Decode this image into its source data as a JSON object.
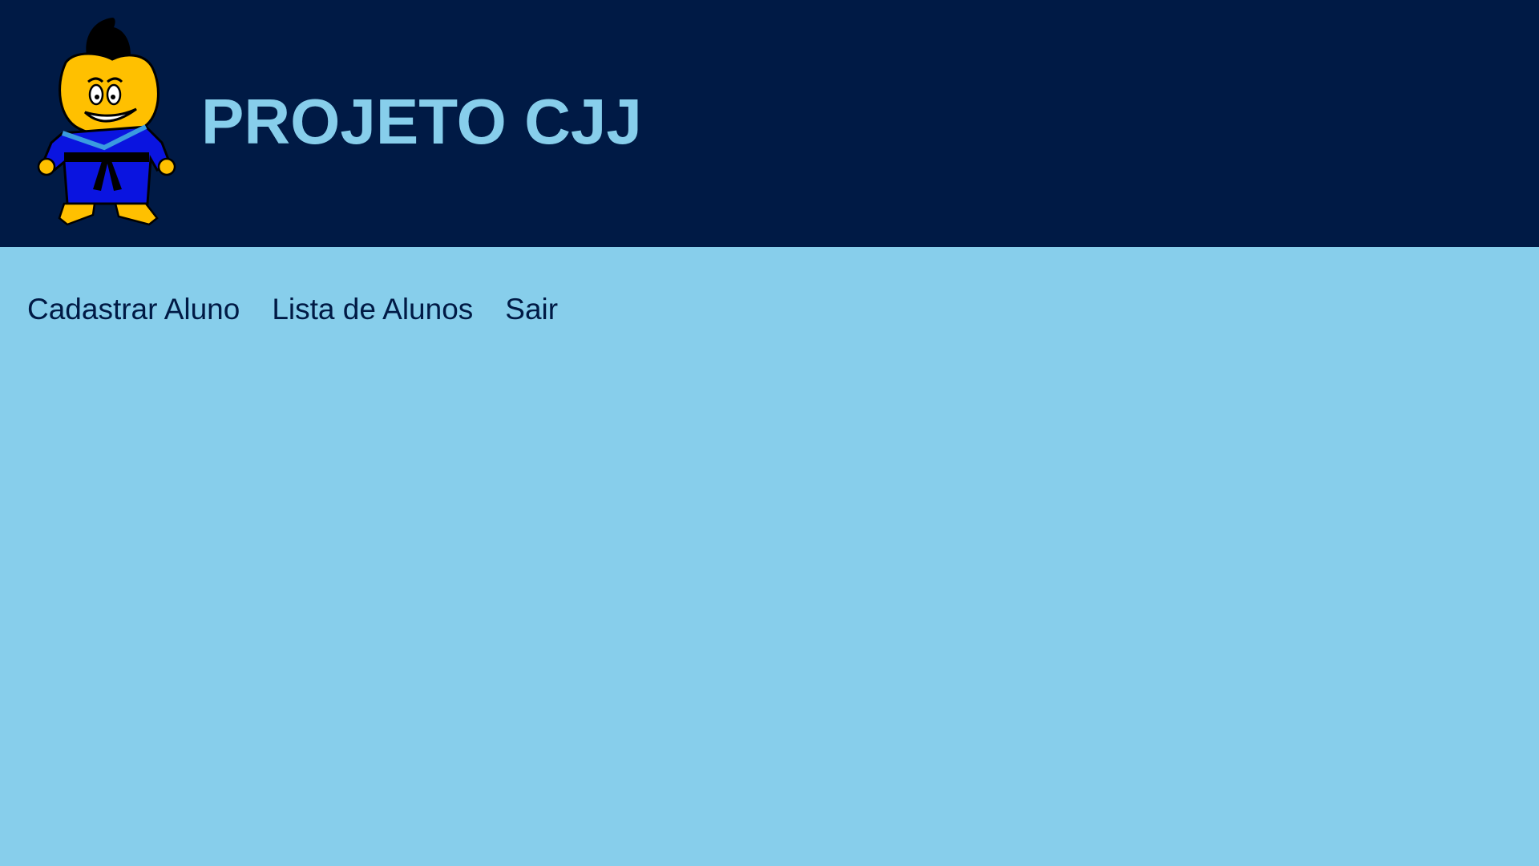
{
  "header": {
    "title": "PROJETO CJJ",
    "logo": "judo-mascot-logo",
    "background_color": "#001a45",
    "title_color": "#87ceeb"
  },
  "nav": {
    "items": [
      {
        "label": "Cadastrar Aluno"
      },
      {
        "label": "Lista de Alunos"
      },
      {
        "label": "Sair"
      }
    ],
    "text_color": "#001a45"
  },
  "page": {
    "background_color": "#87ceeb"
  }
}
